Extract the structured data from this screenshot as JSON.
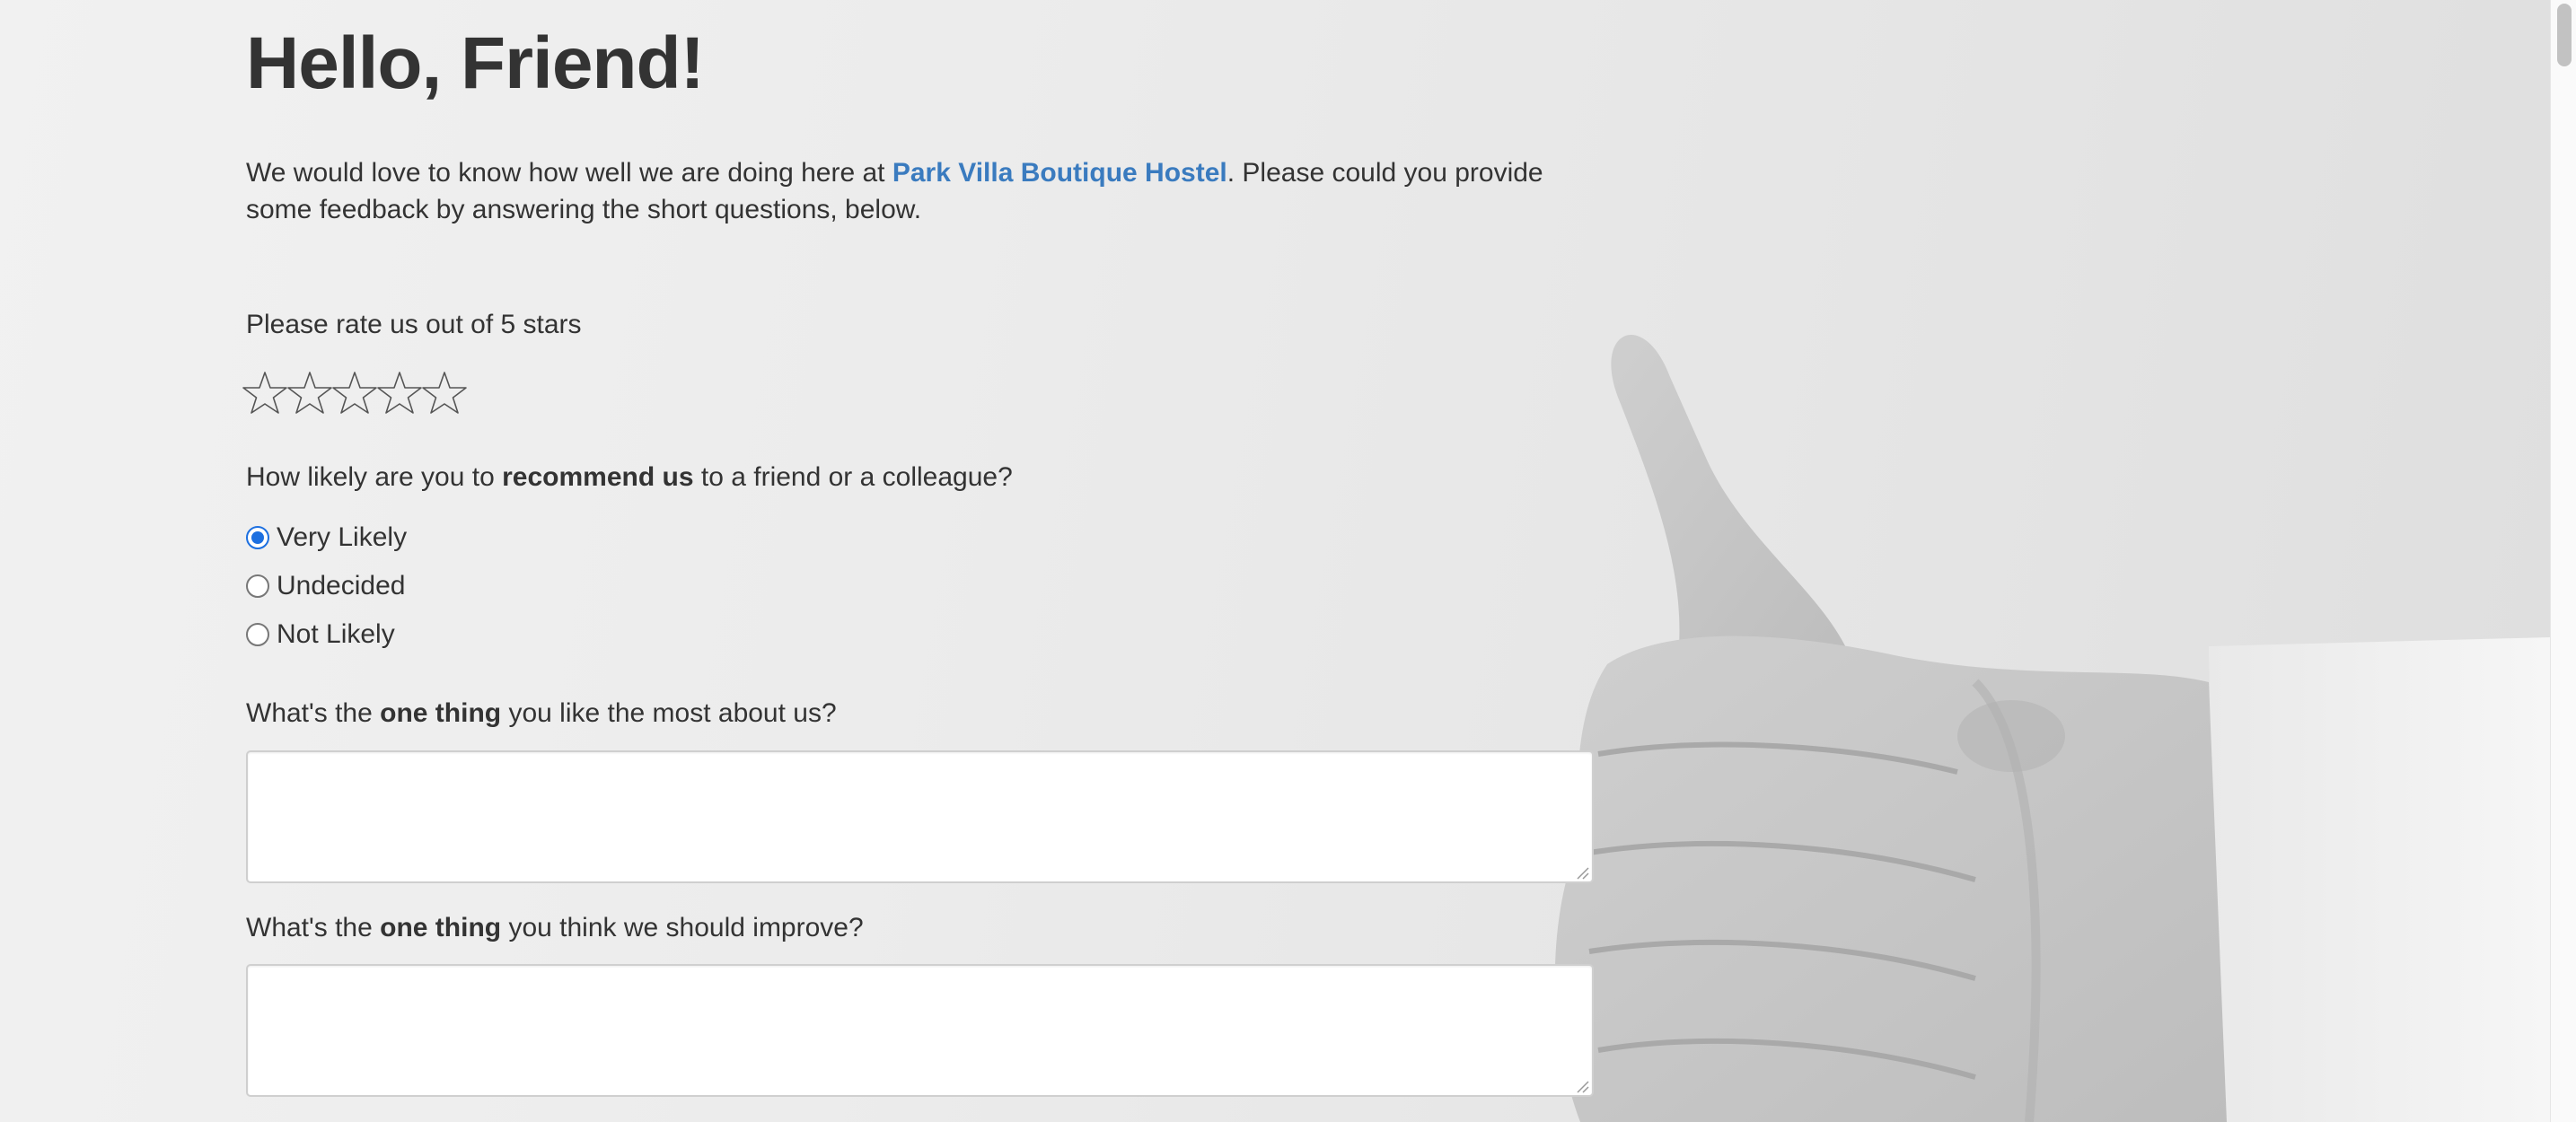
{
  "header": {
    "title": "Hello, Friend!"
  },
  "intro": {
    "before_link": "We would love to know how well we are doing here at ",
    "link_text": "Park Villa Boutique Hostel",
    "after_link": ". Please could you provide some feedback by answering the short questions, below."
  },
  "rating": {
    "label": "Please rate us out of 5 stars",
    "max_stars": 5,
    "selected": 0,
    "star_color": "#555555"
  },
  "recommend": {
    "question_pre": "How likely are you to ",
    "question_bold": "recommend us",
    "question_post": " to a friend or a colleague?",
    "options": [
      {
        "label": "Very Likely",
        "checked": true
      },
      {
        "label": "Undecided",
        "checked": false
      },
      {
        "label": "Not Likely",
        "checked": false
      }
    ]
  },
  "like_most": {
    "question_pre": "What's the ",
    "question_bold": "one thing",
    "question_post": " you like the most about us?",
    "value": ""
  },
  "improve": {
    "question_pre": "What's the ",
    "question_bold": "one thing",
    "question_post": " you think we should improve?",
    "value": ""
  },
  "theme": {
    "link_color": "#3a7bbf",
    "radio_accent": "#1c6fe0"
  },
  "icons": {
    "star": "star-outline-icon",
    "resize": "resize-grip-icon"
  }
}
